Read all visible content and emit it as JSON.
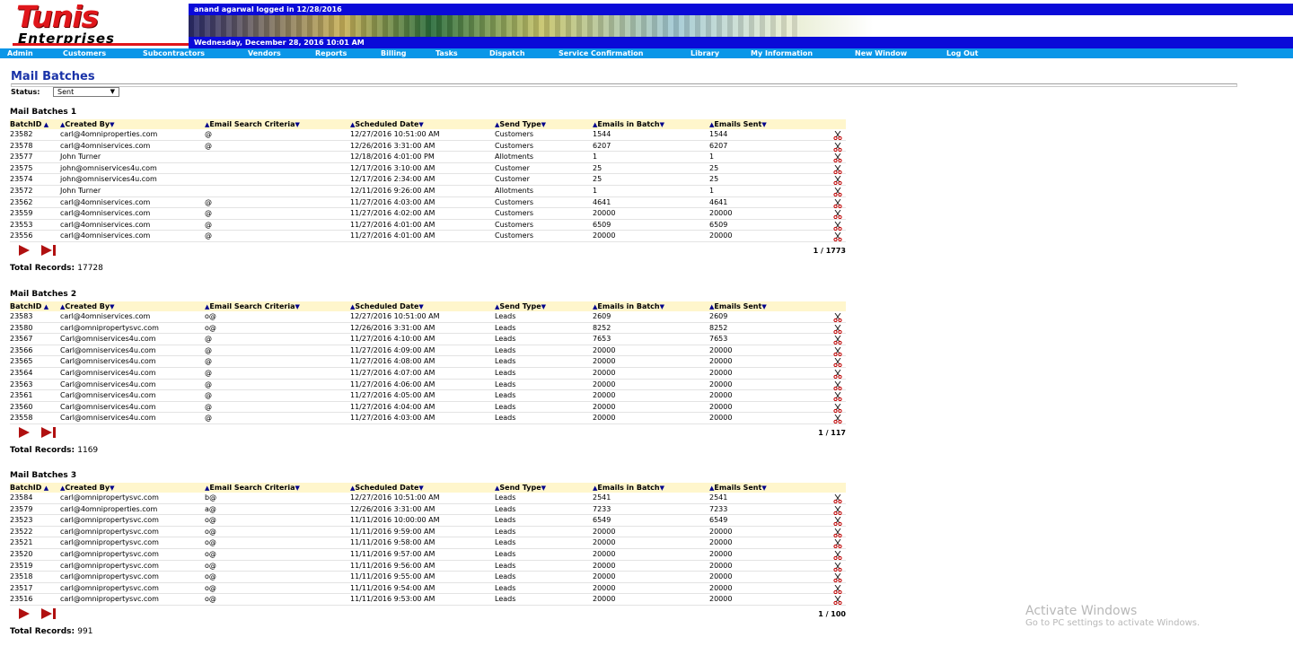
{
  "header": {
    "logo_line1": "Tunis",
    "logo_line2": "Enterprises",
    "login_info": "anand agarwal logged in 12/28/2016",
    "date_info": "Wednesday, December 28, 2016   10:01 AM"
  },
  "nav": {
    "items": [
      {
        "label": "Admin"
      },
      {
        "label": "Customers"
      },
      {
        "label": "Subcontractors"
      },
      {
        "label": "Vendors"
      },
      {
        "label": "Reports"
      },
      {
        "label": "Billing"
      },
      {
        "label": "Tasks"
      },
      {
        "label": "Dispatch"
      },
      {
        "label": "Service Confirmation"
      },
      {
        "label": "Library"
      },
      {
        "label": "My Information"
      },
      {
        "label": "New Window"
      },
      {
        "label": "Log Out"
      }
    ]
  },
  "page": {
    "title": "Mail Batches",
    "status_label": "Status:",
    "status_value": "Sent"
  },
  "columns": [
    "BatchID",
    "Created By",
    "Email Search Criteria",
    "Scheduled Date",
    "Send Type",
    "Emails in Batch",
    "Emails Sent"
  ],
  "sections": [
    {
      "title": "Mail Batches 1",
      "rows": [
        [
          "23582",
          "carl@4omniproperties.com",
          "@",
          "12/27/2016 10:51:00 AM",
          "Customers",
          "1544",
          "1544"
        ],
        [
          "23578",
          "carl@4omniservices.com",
          "@",
          "12/26/2016 3:31:00 AM",
          "Customers",
          "6207",
          "6207"
        ],
        [
          "23577",
          "John Turner",
          "",
          "12/18/2016 4:01:00 PM",
          "Allotments",
          "1",
          "1"
        ],
        [
          "23575",
          "john@omniservices4u.com",
          "",
          "12/17/2016 3:10:00 AM",
          "Customer",
          "25",
          "25"
        ],
        [
          "23574",
          "john@omniservices4u.com",
          "",
          "12/17/2016 2:34:00 AM",
          "Customer",
          "25",
          "25"
        ],
        [
          "23572",
          "John Turner",
          "",
          "12/11/2016 9:26:00 AM",
          "Allotments",
          "1",
          "1"
        ],
        [
          "23562",
          "carl@4omniservices.com",
          "@",
          "11/27/2016 4:03:00 AM",
          "Customers",
          "4641",
          "4641"
        ],
        [
          "23559",
          "carl@4omniservices.com",
          "@",
          "11/27/2016 4:02:00 AM",
          "Customers",
          "20000",
          "20000"
        ],
        [
          "23553",
          "carl@4omniservices.com",
          "@",
          "11/27/2016 4:01:00 AM",
          "Customers",
          "6509",
          "6509"
        ],
        [
          "23556",
          "carl@4omniservices.com",
          "@",
          "11/27/2016 4:01:00 AM",
          "Customers",
          "20000",
          "20000"
        ]
      ],
      "page_count": "1 / 1773",
      "total_label": "Total Records:",
      "total_value": "17728"
    },
    {
      "title": "Mail Batches 2",
      "rows": [
        [
          "23583",
          "carl@4omniservices.com",
          "o@",
          "12/27/2016 10:51:00 AM",
          "Leads",
          "2609",
          "2609"
        ],
        [
          "23580",
          "carl@omnipropertysvc.com",
          "o@",
          "12/26/2016 3:31:00 AM",
          "Leads",
          "8252",
          "8252"
        ],
        [
          "23567",
          "Carl@omniservices4u.com",
          "@",
          "11/27/2016 4:10:00 AM",
          "Leads",
          "7653",
          "7653"
        ],
        [
          "23566",
          "Carl@omniservices4u.com",
          "@",
          "11/27/2016 4:09:00 AM",
          "Leads",
          "20000",
          "20000"
        ],
        [
          "23565",
          "Carl@omniservices4u.com",
          "@",
          "11/27/2016 4:08:00 AM",
          "Leads",
          "20000",
          "20000"
        ],
        [
          "23564",
          "Carl@omniservices4u.com",
          "@",
          "11/27/2016 4:07:00 AM",
          "Leads",
          "20000",
          "20000"
        ],
        [
          "23563",
          "Carl@omniservices4u.com",
          "@",
          "11/27/2016 4:06:00 AM",
          "Leads",
          "20000",
          "20000"
        ],
        [
          "23561",
          "Carl@omniservices4u.com",
          "@",
          "11/27/2016 4:05:00 AM",
          "Leads",
          "20000",
          "20000"
        ],
        [
          "23560",
          "Carl@omniservices4u.com",
          "@",
          "11/27/2016 4:04:00 AM",
          "Leads",
          "20000",
          "20000"
        ],
        [
          "23558",
          "Carl@omniservices4u.com",
          "@",
          "11/27/2016 4:03:00 AM",
          "Leads",
          "20000",
          "20000"
        ]
      ],
      "page_count": "1 / 117",
      "total_label": "Total Records:",
      "total_value": "1169"
    },
    {
      "title": "Mail Batches 3",
      "rows": [
        [
          "23584",
          "carl@omnipropertysvc.com",
          "b@",
          "12/27/2016 10:51:00 AM",
          "Leads",
          "2541",
          "2541"
        ],
        [
          "23579",
          "carl@4omniproperties.com",
          "a@",
          "12/26/2016 3:31:00 AM",
          "Leads",
          "7233",
          "7233"
        ],
        [
          "23523",
          "carl@omnipropertysvc.com",
          "o@",
          "11/11/2016 10:00:00 AM",
          "Leads",
          "6549",
          "6549"
        ],
        [
          "23522",
          "carl@omnipropertysvc.com",
          "o@",
          "11/11/2016 9:59:00 AM",
          "Leads",
          "20000",
          "20000"
        ],
        [
          "23521",
          "carl@omnipropertysvc.com",
          "o@",
          "11/11/2016 9:58:00 AM",
          "Leads",
          "20000",
          "20000"
        ],
        [
          "23520",
          "carl@omnipropertysvc.com",
          "o@",
          "11/11/2016 9:57:00 AM",
          "Leads",
          "20000",
          "20000"
        ],
        [
          "23519",
          "carl@omnipropertysvc.com",
          "o@",
          "11/11/2016 9:56:00 AM",
          "Leads",
          "20000",
          "20000"
        ],
        [
          "23518",
          "carl@omnipropertysvc.com",
          "o@",
          "11/11/2016 9:55:00 AM",
          "Leads",
          "20000",
          "20000"
        ],
        [
          "23517",
          "carl@omnipropertysvc.com",
          "o@",
          "11/11/2016 9:54:00 AM",
          "Leads",
          "20000",
          "20000"
        ],
        [
          "23516",
          "carl@omnipropertysvc.com",
          "o@",
          "11/11/2016 9:53:00 AM",
          "Leads",
          "20000",
          "20000"
        ]
      ],
      "page_count": "1 / 100",
      "total_label": "Total Records:",
      "total_value": "991"
    }
  ],
  "watermark": {
    "line1": "Activate Windows",
    "line2": "Go to PC settings to activate Windows."
  },
  "icons": {
    "delete": "delete-scissors-icon",
    "next": "next-page-icon",
    "last": "last-page-icon",
    "sort": "sort-triangle-icon"
  },
  "colors": {
    "brand_red": "#e0161b",
    "header_blue": "#0a0ad8",
    "nav_blue": "#0a96e8",
    "title_blue": "#1a33a8",
    "grid_header_bg": "#fff6cc",
    "pager_red": "#b01010"
  }
}
